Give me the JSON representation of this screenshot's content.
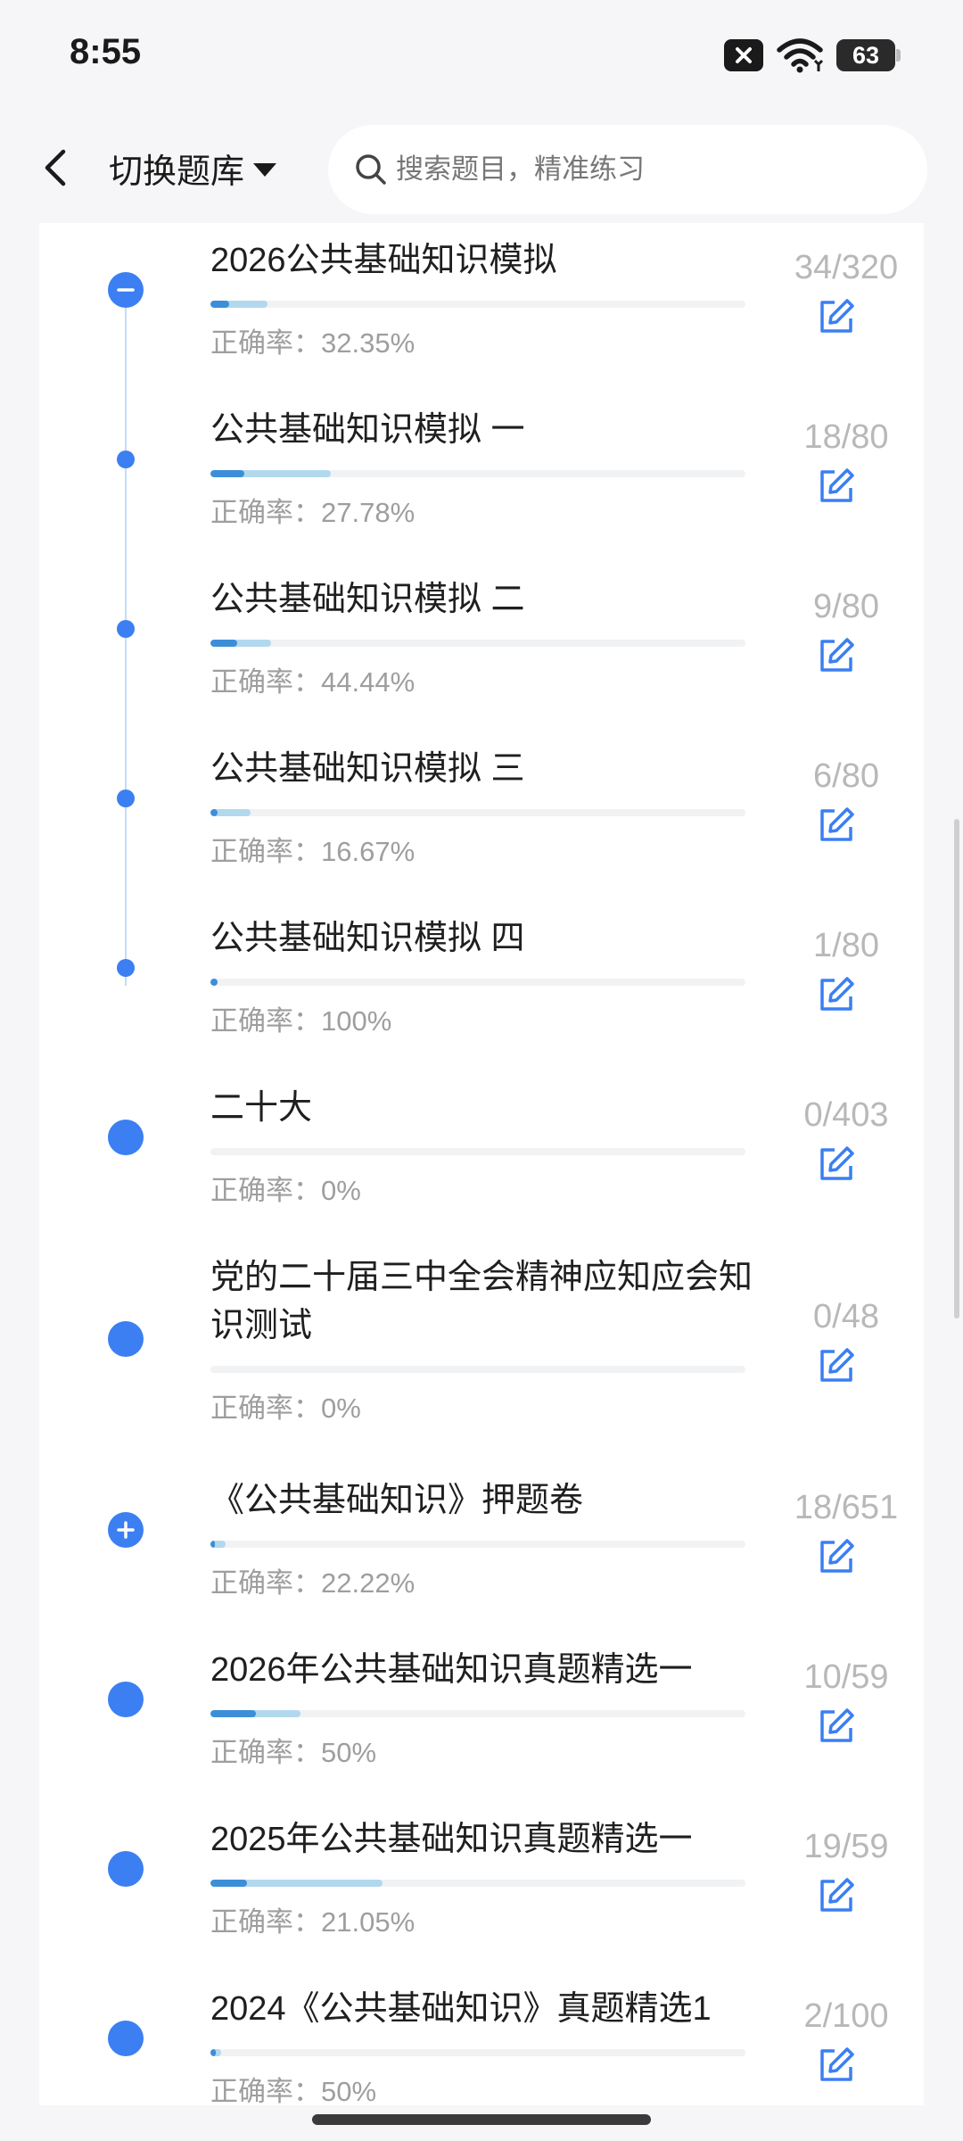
{
  "status": {
    "time": "8:55",
    "battery": "63"
  },
  "header": {
    "title": "切换题库",
    "search_placeholder": "搜索题目，精准练习"
  },
  "accuracy_label": "正确率：",
  "items": [
    {
      "title": "2026公共基础知识模拟",
      "accuracy": "32.35%",
      "count": "34/320",
      "progress": 0.106,
      "correct": 0.0344,
      "dot": "collapse"
    },
    {
      "title": "公共基础知识模拟 一",
      "accuracy": "27.78%",
      "count": "18/80",
      "progress": 0.225,
      "correct": 0.0625,
      "dot": "small"
    },
    {
      "title": "公共基础知识模拟 二",
      "accuracy": "44.44%",
      "count": "9/80",
      "progress": 0.1125,
      "correct": 0.05,
      "dot": "small"
    },
    {
      "title": "公共基础知识模拟 三",
      "accuracy": "16.67%",
      "count": "6/80",
      "progress": 0.075,
      "correct": 0.0125,
      "dot": "small"
    },
    {
      "title": "公共基础知识模拟 四",
      "accuracy": "100%",
      "count": "1/80",
      "progress": 0.0125,
      "correct": 0.0125,
      "dot": "small"
    },
    {
      "title": "二十大",
      "accuracy": "0%",
      "count": "0/403",
      "progress": 0,
      "correct": 0,
      "dot": "big"
    },
    {
      "title": "党的二十届三中全会精神应知应会知识测试",
      "accuracy": "0%",
      "count": "0/48",
      "progress": 0,
      "correct": 0,
      "dot": "big"
    },
    {
      "title": "《公共基础知识》押题卷",
      "accuracy": "22.22%",
      "count": "18/651",
      "progress": 0.0276,
      "correct": 0.0061,
      "dot": "expand"
    },
    {
      "title": "2026年公共基础知识真题精选一",
      "accuracy": "50%",
      "count": "10/59",
      "progress": 0.169,
      "correct": 0.0847,
      "dot": "big"
    },
    {
      "title": "2025年公共基础知识真题精选一",
      "accuracy": "21.05%",
      "count": "19/59",
      "progress": 0.322,
      "correct": 0.0678,
      "dot": "big"
    },
    {
      "title": "2024《公共基础知识》真题精选1",
      "accuracy": "50%",
      "count": "2/100",
      "progress": 0.02,
      "correct": 0.01,
      "dot": "big"
    }
  ]
}
